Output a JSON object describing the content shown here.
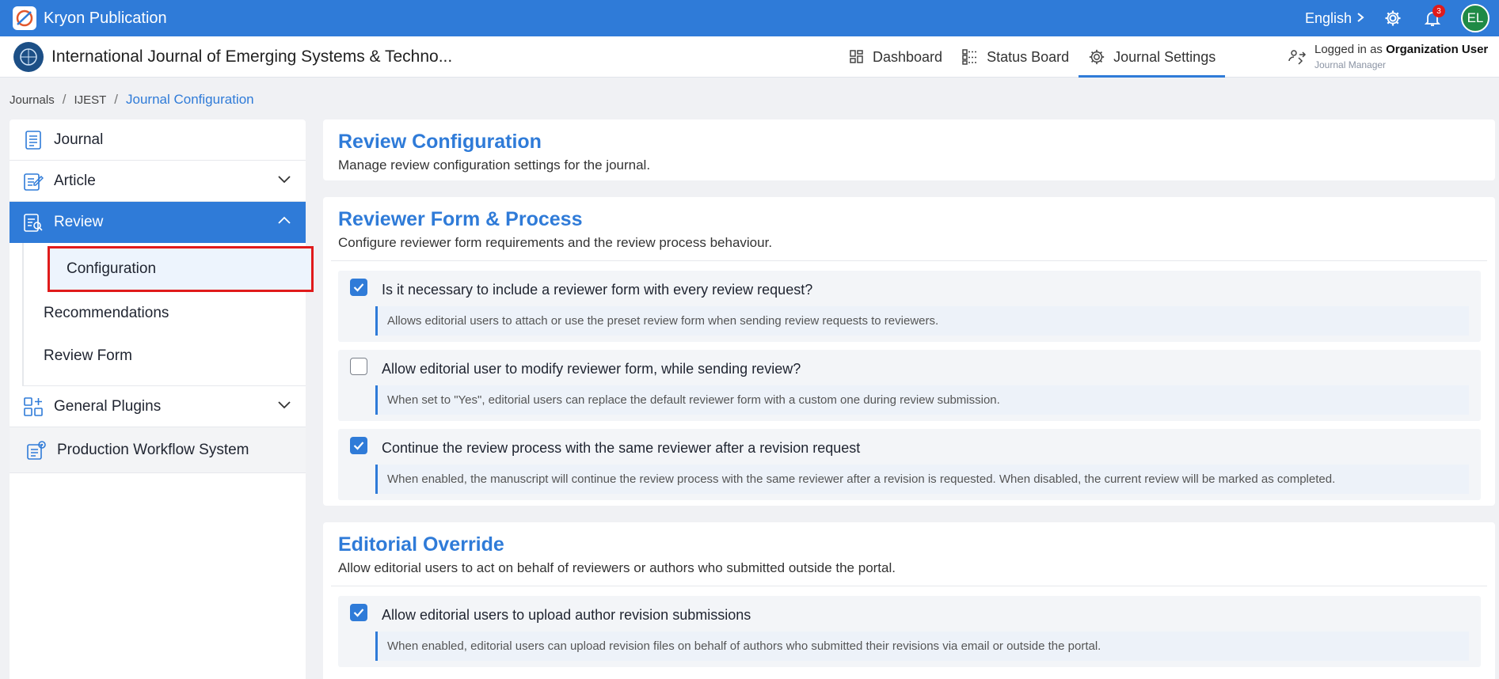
{
  "topbar": {
    "brand": "Kryon Publication",
    "language": "English",
    "notification_count": "3",
    "avatar_initials": "EL"
  },
  "header": {
    "journal_title": "International Journal of Emerging Systems & Techno...",
    "nav": [
      {
        "label": "Dashboard",
        "icon": "dashboard-icon"
      },
      {
        "label": "Status Board",
        "icon": "status-board-icon"
      },
      {
        "label": "Journal Settings",
        "icon": "gear-icon",
        "active": true
      }
    ],
    "login_prefix": "Logged in as",
    "login_org": "Organization User",
    "login_role": "Journal Manager"
  },
  "breadcrumb": [
    "Journals",
    "IJEST",
    "Journal Configuration"
  ],
  "sidebar": {
    "items": [
      {
        "label": "Journal",
        "icon": "journal-icon"
      },
      {
        "label": "Article",
        "icon": "article-icon"
      },
      {
        "label": "Review",
        "icon": "review-icon"
      },
      {
        "label": "General Plugins",
        "icon": "plugins-icon"
      },
      {
        "label": "Production Workflow System",
        "icon": "workflow-icon"
      }
    ],
    "review_sub": [
      "Configuration",
      "Recommendations",
      "Review Form"
    ]
  },
  "main": {
    "header_panel": {
      "title": "Review Configuration",
      "desc": "Manage review configuration settings for the journal."
    },
    "reviewer_panel": {
      "title": "Reviewer Form & Process",
      "desc": "Configure reviewer form requirements and the review process behaviour.",
      "options": [
        {
          "checked": true,
          "question": "Is it necessary to include a reviewer form with every review request?",
          "help": "Allows editorial users to attach or use the preset review form when sending review requests to reviewers."
        },
        {
          "checked": false,
          "question": "Allow editorial user to modify reviewer form, while sending review?",
          "help": "When set to \"Yes\", editorial users can replace the default reviewer form with a custom one during review submission."
        },
        {
          "checked": true,
          "question": "Continue the review process with the same reviewer after a revision request",
          "help": "When enabled, the manuscript will continue the review process with the same reviewer after a revision is requested. When disabled, the current review will be marked as completed."
        }
      ]
    },
    "override_panel": {
      "title": "Editorial Override",
      "desc": "Allow editorial users to act on behalf of reviewers or authors who submitted outside the portal.",
      "options": [
        {
          "checked": true,
          "question": "Allow editorial users to upload author revision submissions",
          "help": "When enabled, editorial users can upload revision files on behalf of authors who submitted their revisions via email or outside the portal."
        }
      ]
    }
  },
  "colors": {
    "primary": "#2f7bd8",
    "highlight": "#e01b1b"
  }
}
